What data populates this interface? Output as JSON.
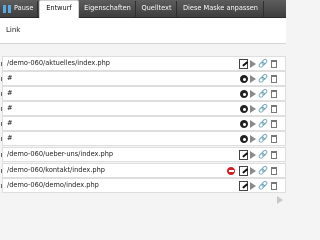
{
  "tabs": [
    {
      "label": "Pause",
      "icon": "pause-icon"
    },
    {
      "label": "Entwurf"
    },
    {
      "label": "Eigenschaften"
    },
    {
      "label": "Quelltext"
    },
    {
      "label": "Diese Maske anpassen"
    }
  ],
  "subbar": {
    "link_label": "Link"
  },
  "rows": [
    {
      "path": "/demo-060/aktuelles/index.php"
    },
    {
      "path": "#"
    },
    {
      "path": "#"
    },
    {
      "path": "#"
    },
    {
      "path": "#"
    },
    {
      "path": "#"
    },
    {
      "path": "/demo-060/ueber-uns/index.php"
    },
    {
      "path": "/demo-060/kontakt/index.php"
    },
    {
      "path": "/demo-060/demo/index.php"
    }
  ],
  "colors": {
    "tab_bar": "#4a4a4a",
    "pause_icon": "#5aa8e0",
    "delete_icon": "#d21f1f"
  }
}
